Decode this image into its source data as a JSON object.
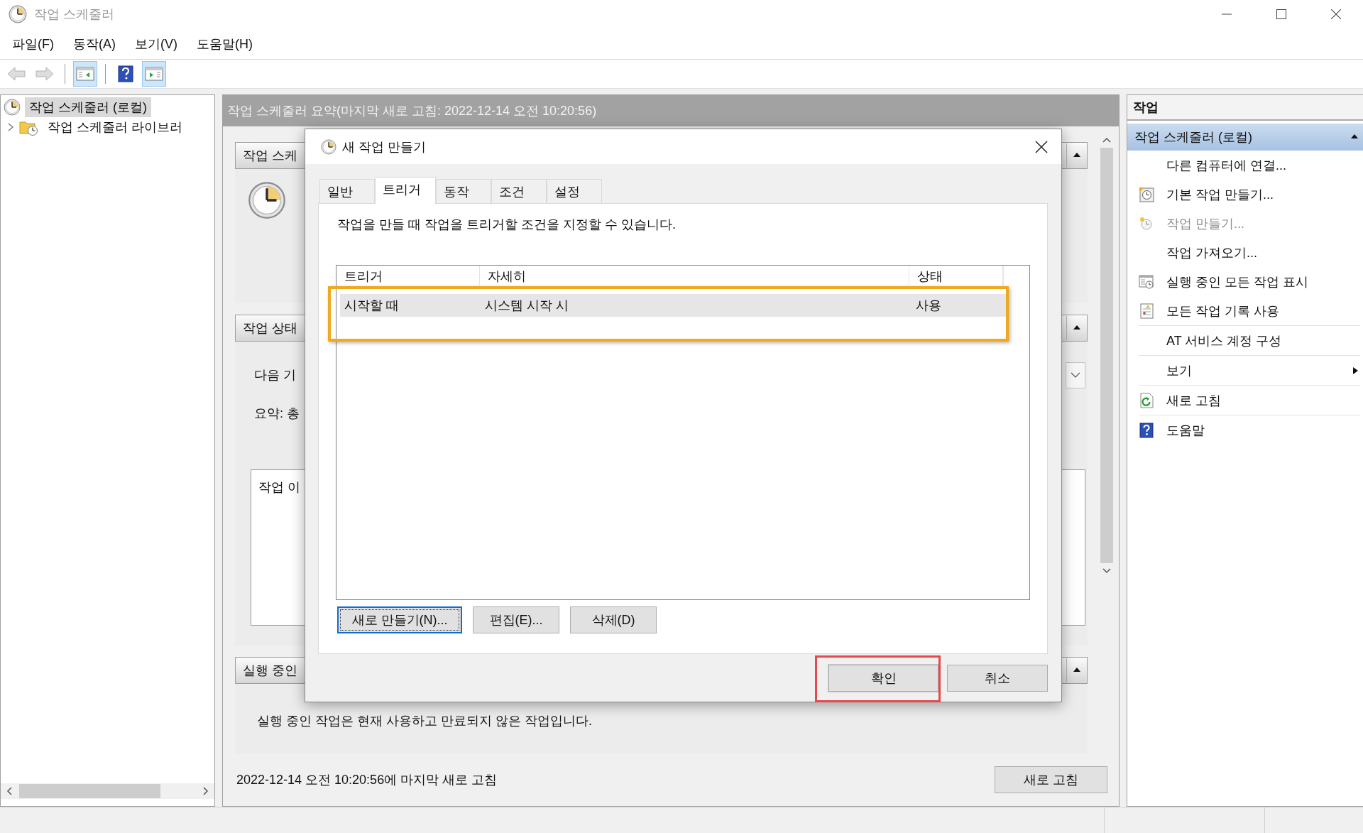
{
  "window": {
    "title": "작업 스케줄러"
  },
  "menu": [
    {
      "label": "파일(F)"
    },
    {
      "label": "동작(A)"
    },
    {
      "label": "보기(V)"
    },
    {
      "label": "도움말(H)"
    }
  ],
  "toolbar": [
    {
      "items": [
        {
          "kind": "back",
          "disabled": true,
          "pressed": false
        },
        {
          "kind": "forward",
          "disabled": true,
          "pressed": false
        }
      ]
    },
    {
      "items": [
        {
          "kind": "console-tree",
          "disabled": false,
          "pressed": true
        }
      ]
    },
    {
      "items": [
        {
          "kind": "help",
          "disabled": false,
          "pressed": false
        },
        {
          "kind": "action-pane",
          "disabled": false,
          "pressed": true
        }
      ]
    }
  ],
  "tree": [
    {
      "label": "작업 스케줄러 (로컬)",
      "selected": true,
      "children": [
        {
          "label": "작업 스케줄러 라이브러",
          "selected": false
        }
      ]
    }
  ],
  "summary": {
    "title": "작업 스케줄러 요약(마지막 새로 고침: 2022-12-14 오전 10:20:56)",
    "sections": [
      {
        "kind": "overview",
        "title": "작업 스케"
      },
      {
        "kind": "status",
        "title": "작업 상태",
        "lines": [
          "다음 기",
          "요약: 총"
        ],
        "box_text": "작업 이"
      },
      {
        "kind": "running",
        "title": "실행 중인",
        "lines": [
          "실행 중인 작업은 현재 사용하고 만료되지 않은 작업입니다."
        ]
      }
    ],
    "footer": "2022-12-14 오전 10:20:56에 마지막 새로 고침",
    "refresh_button": "새로 고침"
  },
  "dialog": {
    "title": "새 작업 만들기",
    "tabs": [
      {
        "label": "일반",
        "selected": false
      },
      {
        "label": "트리거",
        "selected": true
      },
      {
        "label": "동작",
        "selected": false
      },
      {
        "label": "조건",
        "selected": false
      },
      {
        "label": "설정",
        "selected": false
      }
    ],
    "description": "작업을 만들 때 작업을 트리거할 조건을 지정할 수 있습니다.",
    "table": {
      "columns": [
        "트리거",
        "자세히",
        "상태"
      ],
      "rows": [
        {
          "cells": [
            "시작할 때",
            "시스템 시작 시",
            "사용"
          ],
          "selected": true,
          "highlighted": true
        }
      ]
    },
    "list_buttons": [
      {
        "label": "새로 만들기(N)...",
        "focused": true
      },
      {
        "label": "편집(E)...",
        "focused": false
      },
      {
        "label": "삭제(D)",
        "focused": false
      }
    ],
    "buttons": [
      {
        "label": "확인",
        "highlighted": true
      },
      {
        "label": "취소",
        "highlighted": false
      }
    ]
  },
  "actions": {
    "title": "작업",
    "group": {
      "title": "작업 스케줄러 (로컬)",
      "expanded": true
    },
    "sections": [
      {
        "items": [
          {
            "label": "다른 컴퓨터에 연결...",
            "kind": "plain",
            "disabled": false
          },
          {
            "label": "기본 작업 만들기...",
            "kind": "basic-task",
            "disabled": false
          },
          {
            "label": "작업 만들기...",
            "kind": "new-task",
            "disabled": true
          },
          {
            "label": "작업 가져오기...",
            "kind": "plain",
            "disabled": false
          },
          {
            "label": "실행 중인 모든 작업 표시",
            "kind": "running",
            "disabled": false
          },
          {
            "label": "모든 작업 기록 사용",
            "kind": "history",
            "disabled": false
          }
        ]
      },
      {
        "items": [
          {
            "label": "AT 서비스 계정 구성",
            "kind": "plain",
            "disabled": false
          }
        ]
      },
      {
        "items": [
          {
            "label": "보기",
            "kind": "submenu",
            "disabled": false
          }
        ]
      },
      {
        "items": [
          {
            "label": "새로 고침",
            "kind": "refresh",
            "disabled": false
          }
        ]
      },
      {
        "items": [
          {
            "label": "도움말",
            "kind": "help",
            "disabled": false
          }
        ]
      }
    ]
  }
}
